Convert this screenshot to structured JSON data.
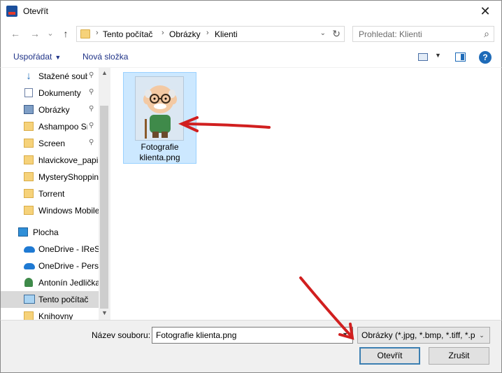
{
  "window": {
    "title": "Otevřít",
    "close_glyph": "✕"
  },
  "nav": {
    "back_glyph": "←",
    "forward_glyph": "→",
    "recent_glyph": "⌄",
    "up_glyph": "↑",
    "breadcrumb": [
      "Tento počítač",
      "Obrázky",
      "Klienti"
    ],
    "separator": "›",
    "search_placeholder": "Prohledat: Klienti"
  },
  "toolbar": {
    "organize_label": "Uspořádat",
    "new_folder_label": "Nová složka",
    "help_label": "?"
  },
  "sidebar": {
    "items": [
      {
        "label": "Stažené soub",
        "icon": "download-icon",
        "pinned": true
      },
      {
        "label": "Dokumenty",
        "icon": "document-icon",
        "pinned": true
      },
      {
        "label": "Obrázky",
        "icon": "pictures-icon",
        "pinned": true
      },
      {
        "label": "Ashampoo Sn",
        "icon": "folder-icon",
        "pinned": true
      },
      {
        "label": "Screen",
        "icon": "folder-icon",
        "pinned": true
      },
      {
        "label": "hlavickove_papir",
        "icon": "folder-icon",
        "pinned": false
      },
      {
        "label": "MysteryShoppin",
        "icon": "folder-icon",
        "pinned": false
      },
      {
        "label": "Torrent",
        "icon": "folder-icon",
        "pinned": false
      },
      {
        "label": "Windows Mobile",
        "icon": "folder-icon",
        "pinned": false
      },
      {
        "label": "Plocha",
        "icon": "desktop-icon",
        "pinned": false
      },
      {
        "label": "OneDrive - IReSo",
        "icon": "onedrive-icon",
        "pinned": false
      },
      {
        "label": "OneDrive - Perso",
        "icon": "onedrive-icon",
        "pinned": false
      },
      {
        "label": "Antonín Jedlička",
        "icon": "user-icon",
        "pinned": false
      },
      {
        "label": "Tento počítač",
        "icon": "computer-icon",
        "pinned": false,
        "selected": true
      },
      {
        "label": "Knihovny",
        "icon": "libraries-icon",
        "pinned": false
      }
    ],
    "pin_glyph": "📌"
  },
  "files": [
    {
      "name_line1": "Fotografie",
      "name_line2": "klienta.png",
      "selected": true
    }
  ],
  "bottom": {
    "filename_label": "Název souboru:",
    "filename_value": "Fotografie klienta.png",
    "filter_value": "Obrázky (*.jpg, *.bmp, *.tiff, *.p",
    "open_label": "Otevřít",
    "cancel_label": "Zrušit"
  },
  "colors": {
    "selection": "#cce8ff",
    "selection_border": "#99d1ff",
    "annotation_arrow": "#d11f1f",
    "link_blue": "#1e3287"
  }
}
